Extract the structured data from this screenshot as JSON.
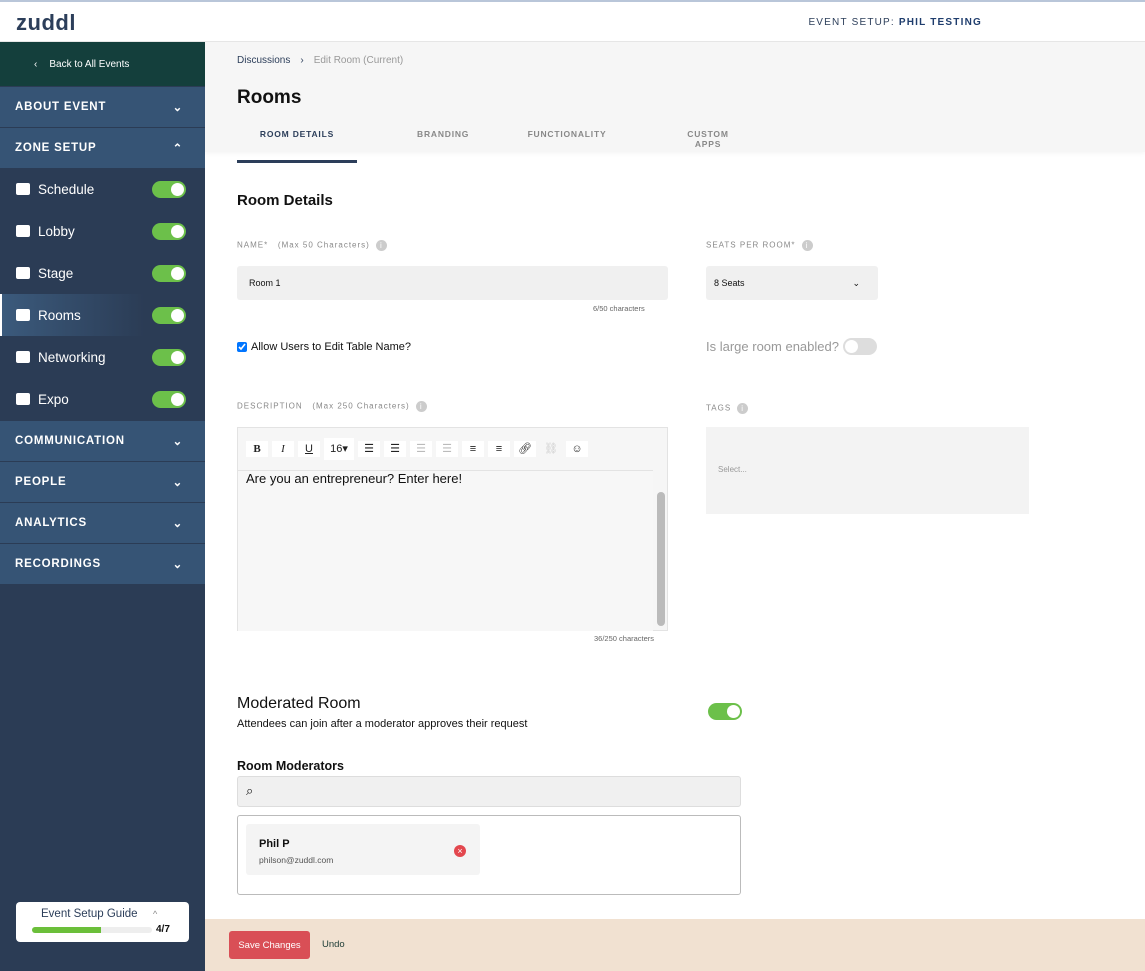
{
  "header": {
    "logo": "zuddl",
    "event_prefix": "EVENT SETUP: ",
    "event_name": "PHIL TESTING"
  },
  "sidebar": {
    "back": "Back to All Events",
    "sections": {
      "about": "ABOUT EVENT",
      "zone": "ZONE SETUP",
      "communication": "COMMUNICATION",
      "people": "PEOPLE",
      "analytics": "ANALYTICS",
      "recordings": "RECORDINGS"
    },
    "items": [
      {
        "label": "Schedule",
        "enabled": true
      },
      {
        "label": "Lobby",
        "enabled": true
      },
      {
        "label": "Stage",
        "enabled": true
      },
      {
        "label": "Rooms",
        "enabled": true
      },
      {
        "label": "Networking",
        "enabled": true
      },
      {
        "label": "Expo",
        "enabled": true
      }
    ],
    "guide": {
      "title": "Event Setup Guide",
      "progress": "4/7",
      "fraction": 0.571
    }
  },
  "breadcrumb": {
    "parent": "Discussions",
    "current": "Edit Room (Current)"
  },
  "page_title": "Rooms",
  "tabs": [
    "ROOM DETAILS",
    "BRANDING",
    "FUNCTIONALITY",
    "CUSTOM APPS"
  ],
  "form": {
    "section_title": "Room Details",
    "name_label": "NAME*",
    "name_hint": "(Max 50 Characters)",
    "name_value": "Room 1",
    "name_count": "6/50 characters",
    "seats_label": "SEATS PER ROOM*",
    "seats_value": "8 Seats",
    "allow_edit": "Allow Users to Edit Table Name?",
    "large_room": "Is large room enabled?",
    "desc_label": "DESCRIPTION",
    "desc_hint": "(Max 250 Characters)",
    "desc_value": "Are you an entrepreneur? Enter here!",
    "desc_count": "36/250 characters",
    "font_size": "16",
    "tags_label": "TAGS",
    "tags_placeholder": "Select...",
    "moderated_title": "Moderated Room",
    "moderated_desc": "Attendees can join after a moderator approves their request",
    "moderators_label": "Room Moderators",
    "moderator": {
      "name": "Phil P",
      "email": "philson@zuddl.com"
    }
  },
  "footer": {
    "save": "Save Changes",
    "undo": "Undo"
  }
}
